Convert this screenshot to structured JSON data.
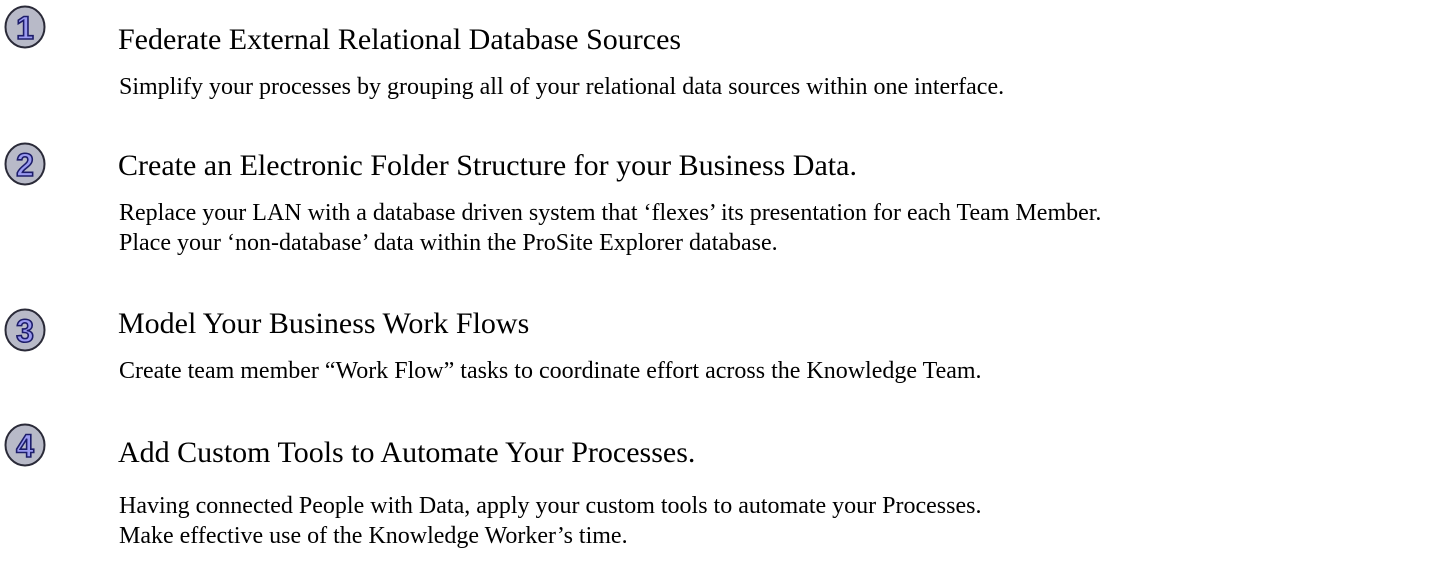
{
  "colors": {
    "badge_fill": "#b8bac8",
    "badge_stroke": "#2a2a38",
    "numeral_fill": "#9a9af0",
    "numeral_stroke": "#1c1c6a",
    "text": "#000000"
  },
  "steps": [
    {
      "number": "1",
      "icon": "number-one-badge-icon",
      "title": "Federate External Relational Database Sources",
      "lines": [
        "Simplify your processes by grouping all of your relational data sources within one interface."
      ]
    },
    {
      "number": "2",
      "icon": "number-two-badge-icon",
      "title": "Create an Electronic Folder Structure for your Business Data.",
      "lines": [
        "Replace your LAN with a database driven system that ‘flexes’ its presentation for each Team Member.",
        "Place your ‘non-database’ data within the ProSite Explorer database."
      ]
    },
    {
      "number": "3",
      "icon": "number-three-badge-icon",
      "title": "Model Your Business Work Flows",
      "lines": [
        "Create team member “Work Flow” tasks to coordinate effort across the Knowledge Team."
      ]
    },
    {
      "number": "4",
      "icon": "number-four-badge-icon",
      "title": "Add Custom Tools to Automate Your Processes.",
      "lines": [
        "Having connected People with Data, apply your custom tools to automate your Processes.",
        "Make effective use of the Knowledge Worker’s time."
      ]
    }
  ]
}
